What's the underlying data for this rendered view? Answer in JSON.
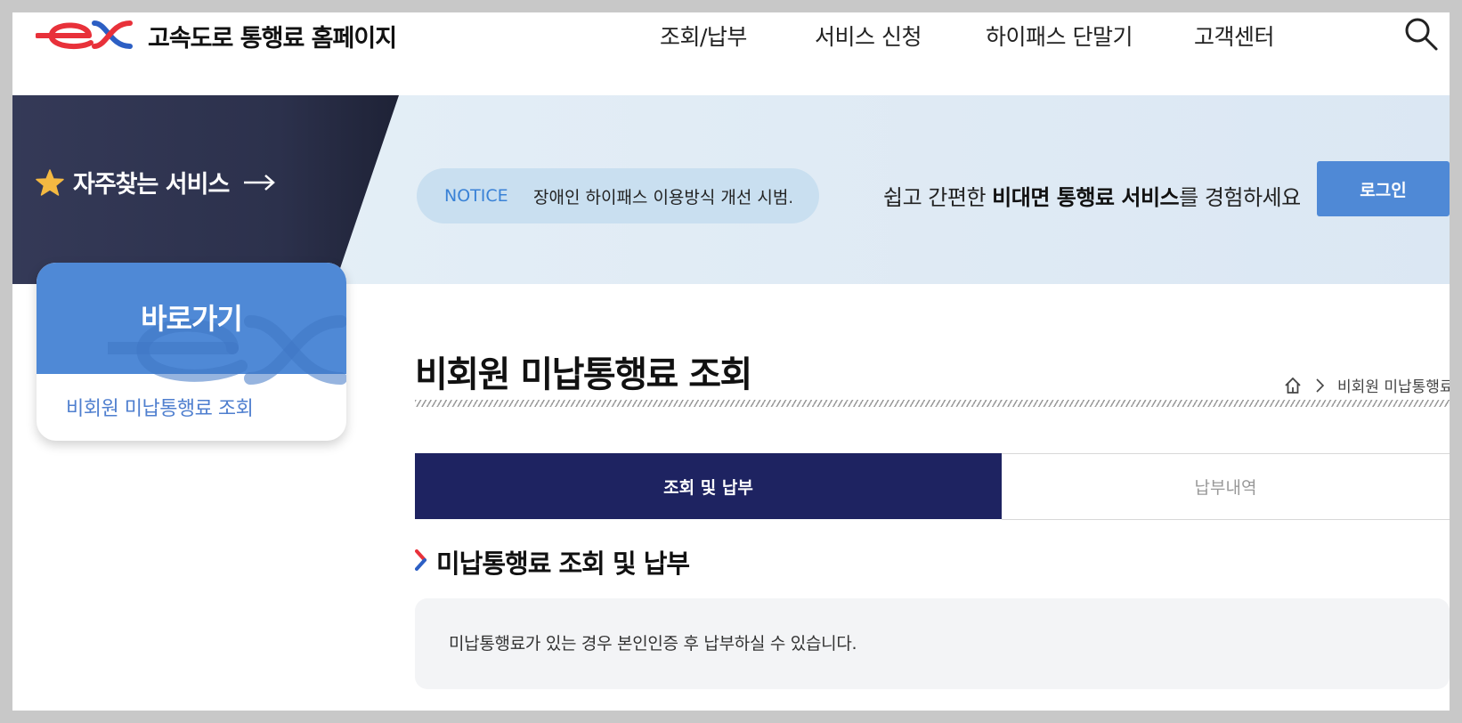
{
  "header": {
    "site_title": "고속도로 통행료 홈페이지",
    "nav": [
      "조회/납부",
      "서비스 신청",
      "하이패스 단말기",
      "고객센터"
    ],
    "logo_icon": "ex-logo",
    "search_icon": "search-icon"
  },
  "banner": {
    "favorites_label": "자주찾는 서비스",
    "favorites_icon": "star-icon",
    "notice_label": "NOTICE",
    "notice_text": "장애인 하이패스 이용방식 개선 시범...",
    "promo_prefix": "쉽고 간편한 ",
    "promo_bold": "비대면 통행료 서비스",
    "promo_suffix": "를 경험하세요",
    "login_label": "로그인"
  },
  "quick_links": {
    "title": "바로가기",
    "items": [
      "비회원 미납통행료 조회"
    ]
  },
  "page": {
    "title": "비회원 미납통행료 조회",
    "breadcrumb": "비회원 미납통행료 조회"
  },
  "tabs": [
    {
      "label": "조회 및 납부",
      "active": true
    },
    {
      "label": "납부내역",
      "active": false
    }
  ],
  "section": {
    "title": "미납통행료 조회 및 납부",
    "info": "미납통행료가 있는 경우 본인인증 후 납부하실 수 있습니다."
  },
  "colors": {
    "primary_blue": "#4f89d6",
    "navy": "#1e2361",
    "banner_dark": "#2a2f48",
    "logo_red": "#e8313a",
    "logo_blue": "#2c5fc4"
  }
}
